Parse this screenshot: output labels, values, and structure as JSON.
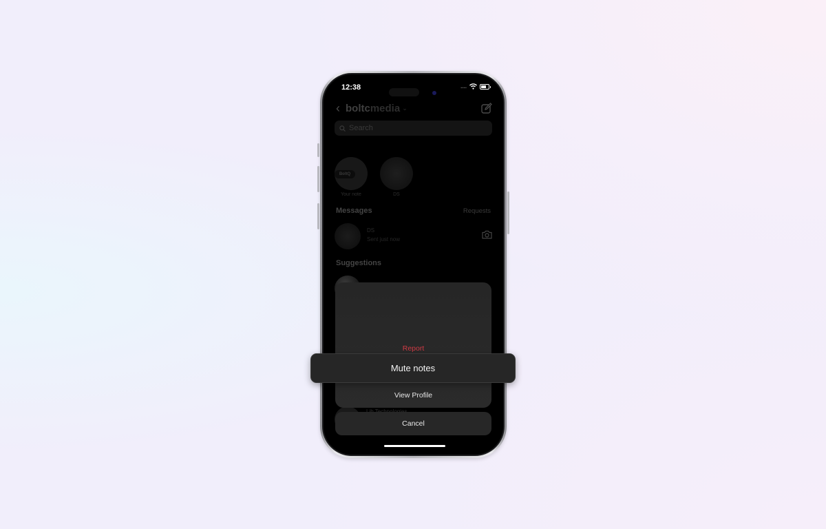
{
  "status_bar": {
    "time": "12:38",
    "signal": "....",
    "wifi_icon": "wifi-icon",
    "battery_icon": "battery-icon"
  },
  "nav": {
    "back_icon": "chevron-left-icon",
    "account_bold": "boltc",
    "account_rest": "media",
    "dropdown_icon": "chevron-down-icon",
    "compose_icon": "compose-icon"
  },
  "search": {
    "placeholder": "Search"
  },
  "notes": [
    {
      "label": "Your note",
      "badge": "BoltQ"
    },
    {
      "label": "DS"
    }
  ],
  "messages": {
    "heading": "Messages",
    "requests_label": "Requests",
    "items": [
      {
        "name": "DS",
        "status": "Sent just now"
      }
    ]
  },
  "suggestions": {
    "heading": "Suggestions",
    "items": [
      {
        "name": ""
      },
      {
        "name": "Lib Technologies"
      }
    ]
  },
  "action_sheet": {
    "report_label": "Report",
    "mute_notes_label": "Mute notes",
    "view_profile_label": "View Profile",
    "cancel_label": "Cancel"
  },
  "colors": {
    "danger": "#d13b45",
    "sheet_bg": "#262626",
    "screen_bg": "#000000"
  }
}
